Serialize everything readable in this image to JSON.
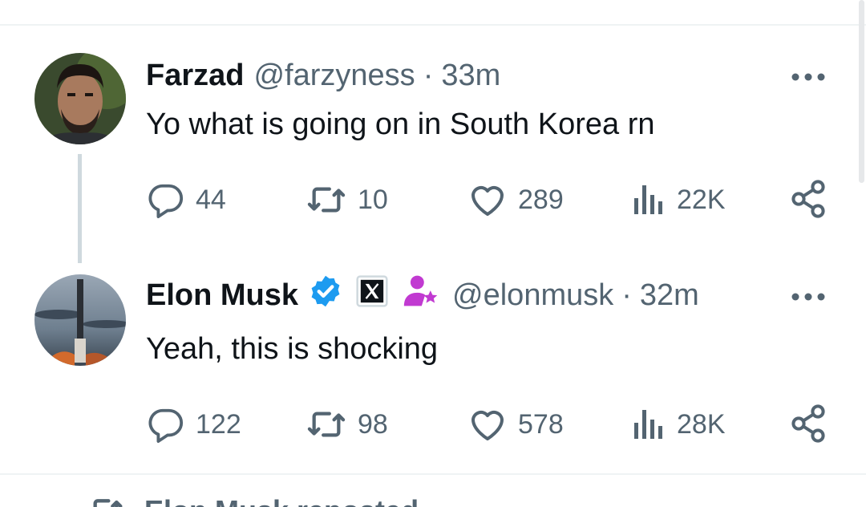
{
  "tweets": [
    {
      "name": "Farzad",
      "handle": "@farzyness",
      "time": "33m",
      "text": "Yo what is going on in South Korea rn",
      "replies": "44",
      "reposts": "10",
      "likes": "289",
      "views": "22K"
    },
    {
      "name": "Elon Musk",
      "handle": "@elonmusk",
      "time": "32m",
      "text": "Yeah, this is shocking",
      "replies": "122",
      "reposts": "98",
      "likes": "578",
      "views": "28K"
    }
  ],
  "separator": "·",
  "next_item": {
    "context_text": "Elon Musk reposted"
  },
  "colors": {
    "verified": "#1d9bf0",
    "secondary_text": "#536471",
    "thread_line": "#cfd9de",
    "badge_purple": "#c13ad1"
  },
  "icons": [
    "more-icon",
    "reply-icon",
    "repost-icon",
    "like-icon",
    "views-icon",
    "share-icon",
    "verified-badge-icon",
    "x-affiliate-icon",
    "subscriber-icon"
  ]
}
